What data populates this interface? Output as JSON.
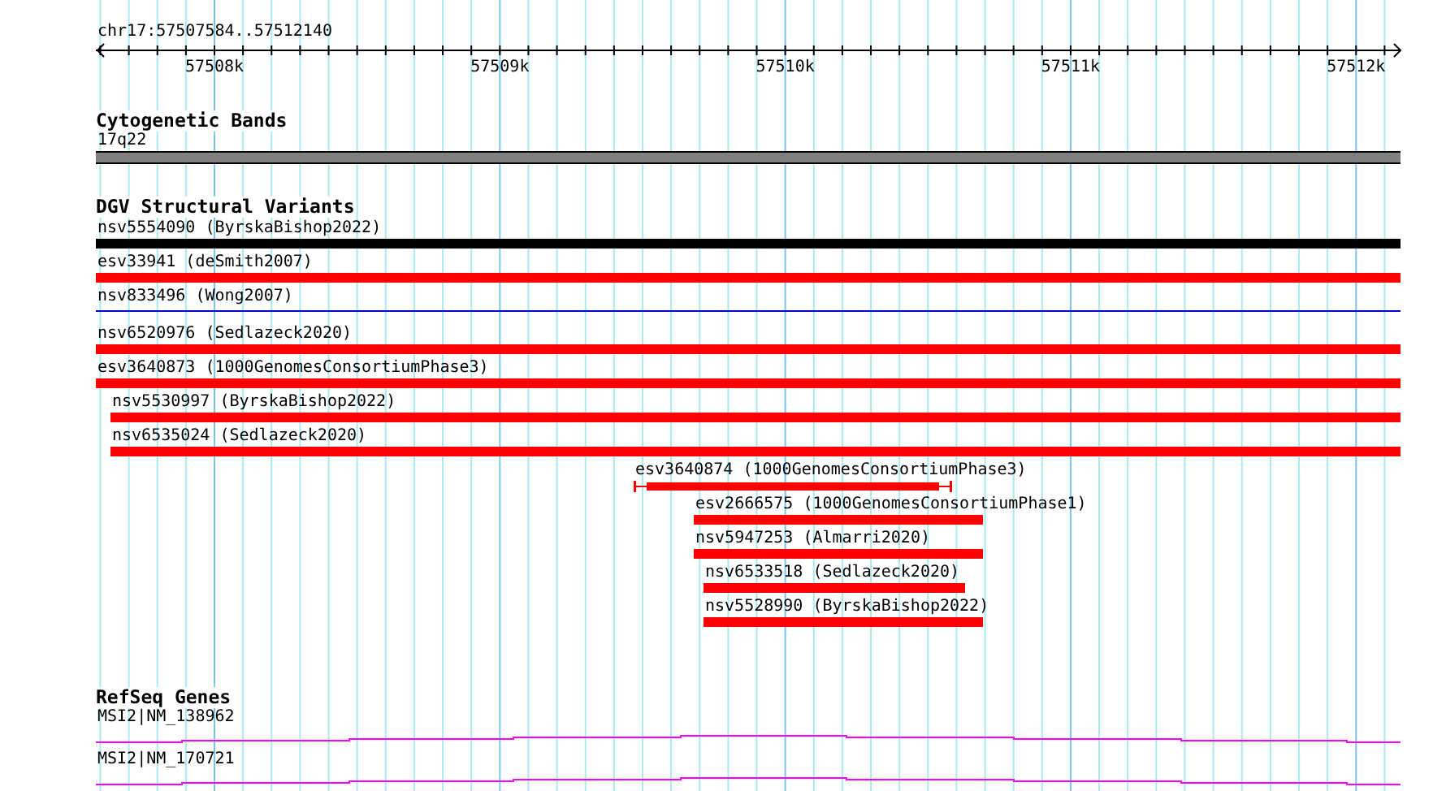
{
  "location": "chr17:57507584..57512140",
  "ruler": {
    "ticks": [
      "57508k",
      "57509k",
      "57510k",
      "57511k",
      "57512k"
    ]
  },
  "tracks": [
    {
      "kind": "bands",
      "title": "Cytogenetic Bands",
      "features": [
        {
          "label": "17q22",
          "color": "#808080"
        }
      ]
    },
    {
      "kind": "variants",
      "title": "DGV Structural Variants",
      "features": [
        {
          "label": "nsv5554090 (ByrskaBishop2022)",
          "kind": "bar",
          "color": "#000000"
        },
        {
          "label": "esv33941 (deSmith2007)",
          "kind": "bar",
          "color": "#ff0000"
        },
        {
          "label": "nsv833496 (Wong2007)",
          "kind": "line",
          "color": "#0000cc"
        },
        {
          "label": "nsv6520976 (Sedlazeck2020)",
          "kind": "bar",
          "color": "#ff0000"
        },
        {
          "label": "esv3640873 (1000GenomesConsortiumPhase3)",
          "kind": "bar",
          "color": "#ff0000"
        },
        {
          "label": "nsv5530997 (ByrskaBishop2022)",
          "kind": "bar",
          "color": "#ff0000"
        },
        {
          "label": "nsv6535024 (Sedlazeck2020)",
          "kind": "bar",
          "color": "#ff0000"
        },
        {
          "label": "esv3640874 (1000GenomesConsortiumPhase3)",
          "kind": "capped",
          "color": "#ff0000"
        },
        {
          "label": "esv2666575 (1000GenomesConsortiumPhase1)",
          "kind": "bar",
          "color": "#ff0000"
        },
        {
          "label": "nsv5947253 (Almarri2020)",
          "kind": "bar",
          "color": "#ff0000"
        },
        {
          "label": "nsv6533518 (Sedlazeck2020)",
          "kind": "bar",
          "color": "#ff0000"
        },
        {
          "label": "nsv5528990 (ByrskaBishop2022)",
          "kind": "bar",
          "color": "#ff0000"
        }
      ]
    },
    {
      "kind": "genes",
      "title": "RefSeq Genes",
      "features": [
        {
          "label": "MSI2|NM_138962",
          "color": "#ff00ff"
        },
        {
          "label": "MSI2|NM_170721",
          "color": "#ff00ff"
        }
      ]
    }
  ]
}
